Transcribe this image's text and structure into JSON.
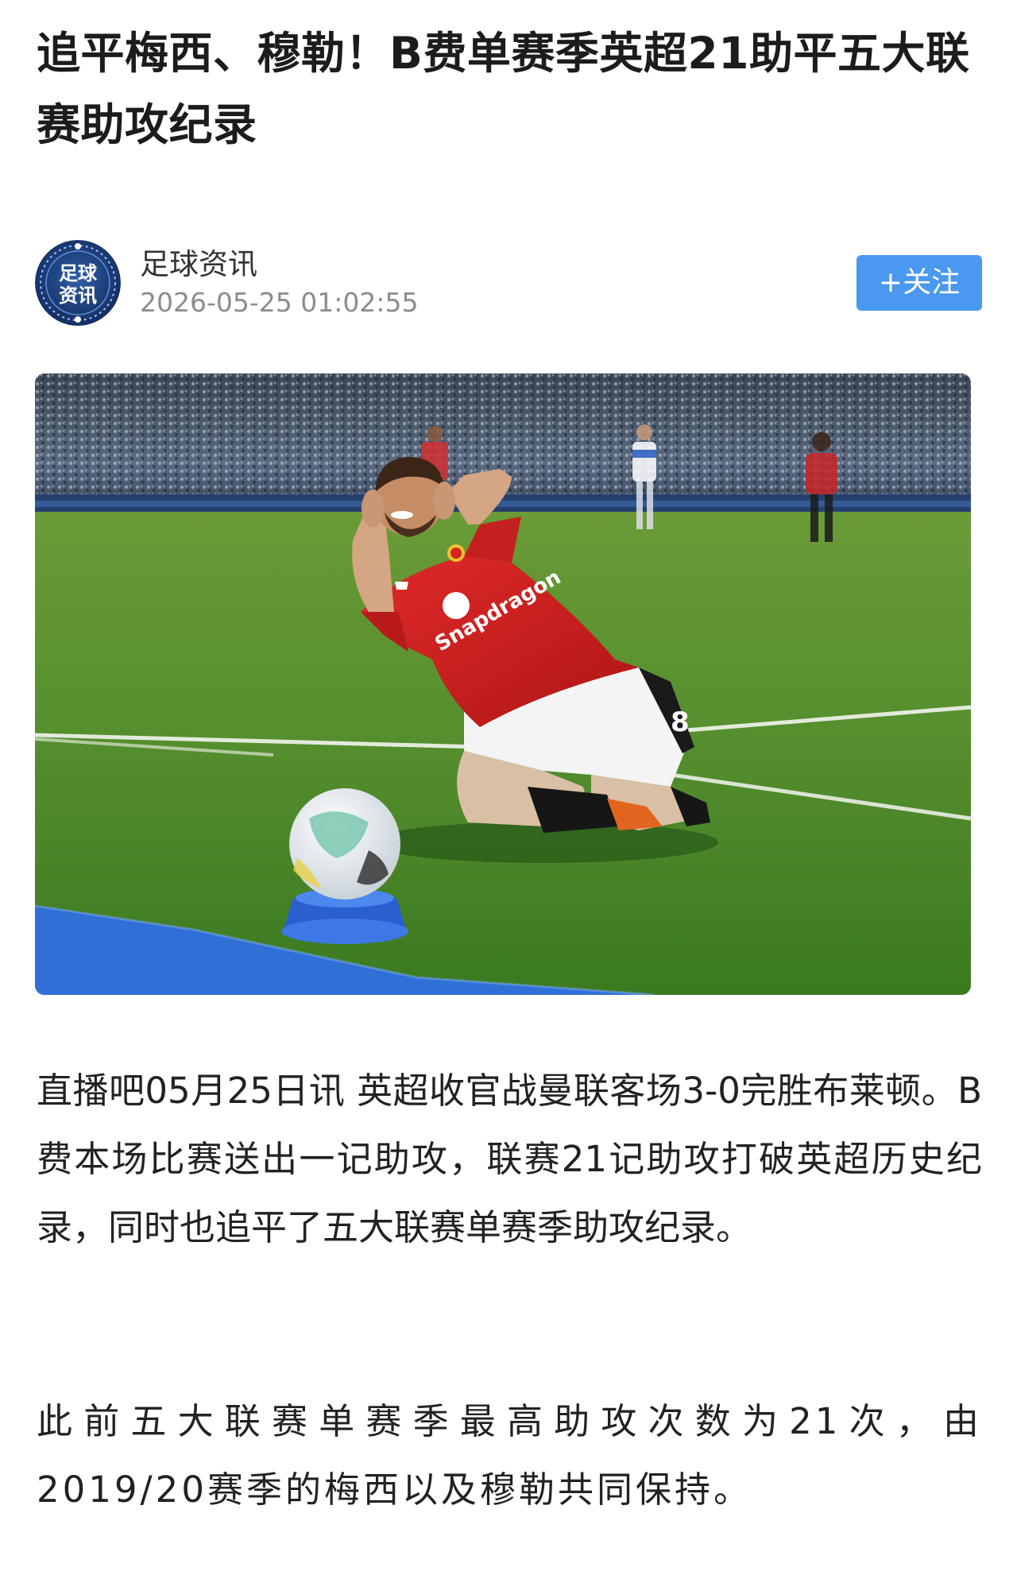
{
  "article": {
    "title": "追平梅西、穆勒！B费单赛季英超21助平五大联赛助攻纪录",
    "author": {
      "name": "足球资讯",
      "time": "2026-05-25 01:02:55",
      "avatar_text_top": "足球",
      "avatar_text_bottom": "资讯"
    },
    "follow_label": "+关注",
    "paragraphs": [
      "直播吧05月25日讯 英超收官战曼联客场3-0完胜布莱顿。B费本场比赛送出一记助攻，联赛21记助攻打破英超历史纪录，同时也追平了五大联赛单赛季助攻纪录。",
      "此前五大联赛单赛季最高助攻次数为21次，由2019/20赛季的梅西以及穆勒共同保持。"
    ],
    "photo": {
      "shirt_sponsor": "Snapdragon",
      "shirt_number": "8"
    }
  },
  "colors": {
    "follow_button": "#4a98f0",
    "avatar_bg": "#1f3f7a",
    "title_text": "#1c1c1c",
    "meta_text": "#8c8c8c"
  }
}
